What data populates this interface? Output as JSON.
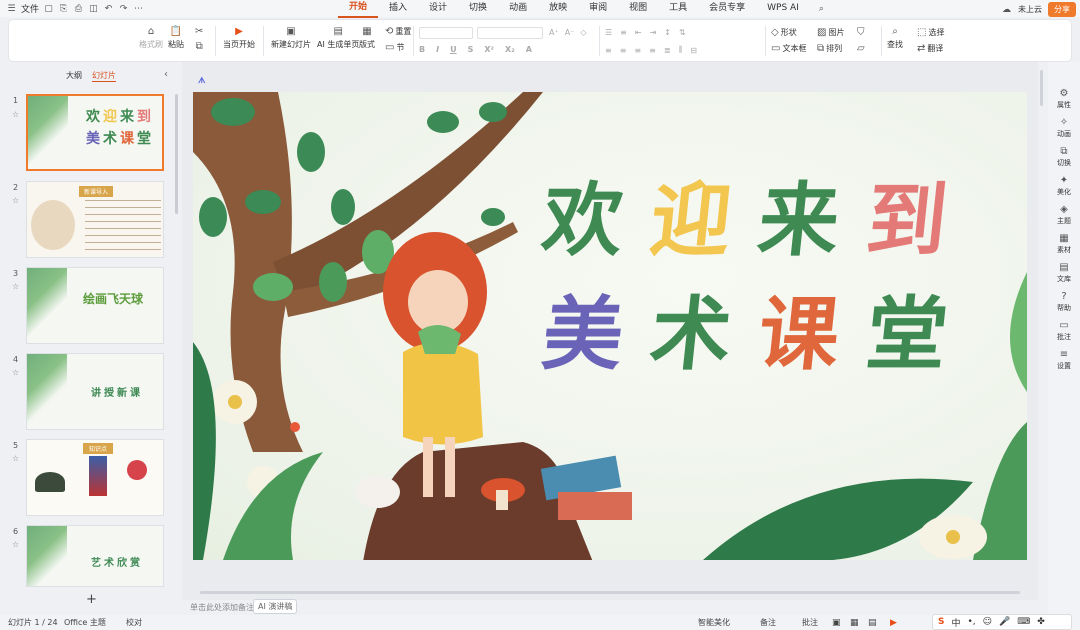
{
  "menubar": {
    "file_label": "文件",
    "tabs": [
      "开始",
      "插入",
      "设计",
      "切换",
      "动画",
      "放映",
      "审阅",
      "视图",
      "工具",
      "会员专享",
      "WPS AI"
    ],
    "active_tab": "开始",
    "cloud_label": "未上云",
    "share_label": "分享"
  },
  "ribbon": {
    "format_painter": "格式刷",
    "paste": "粘贴",
    "start_from_current": "当页开始",
    "new_slide": "新建幻灯片",
    "ai_generate": "AI 生成单页",
    "layout": "版式",
    "reset": "重置",
    "section": "节",
    "shape": "形状",
    "picture": "图片",
    "textbox": "文本框",
    "arrange": "排列",
    "find": "查找",
    "select": "选择",
    "translate": "翻译",
    "font_size_buttons": [
      "A⁺",
      "A⁻",
      "◇"
    ]
  },
  "panel": {
    "tab_outline": "大纲",
    "tab_slides": "幻灯片",
    "active_tab": "幻灯片",
    "thumbnails": [
      {
        "num": "1",
        "title": "欢迎来到 美术课堂"
      },
      {
        "num": "2",
        "title": "新课导入"
      },
      {
        "num": "3",
        "title": "绘画飞天球"
      },
      {
        "num": "4",
        "title": "讲授新课"
      },
      {
        "num": "5",
        "title": "知识点"
      },
      {
        "num": "6",
        "title": "艺术欣赏"
      }
    ]
  },
  "slide": {
    "title_line1": [
      "欢",
      "迎",
      "来",
      "到"
    ],
    "title_line2": [
      "美",
      "术",
      "课",
      "堂"
    ],
    "colors_line1": [
      "#3e8a52",
      "#f2c64f",
      "#3e8a52",
      "#e47a78"
    ],
    "colors_line2": [
      "#6a64b8",
      "#3e8a52",
      "#e0673c",
      "#3e8a52"
    ]
  },
  "notes_hint": "单击此处添加备注",
  "ai_speech": "AI 演讲稿",
  "sidebar": [
    "属性",
    "动画",
    "切换",
    "美化",
    "主题",
    "素材",
    "文库",
    "帮助",
    "批注",
    "设置"
  ],
  "status": {
    "slide_count": "幻灯片 1 / 24",
    "theme": "Office 主题",
    "proofing": "校对",
    "smart_beautify": "智能美化",
    "notes": "备注",
    "comments": "批注"
  },
  "ime": {
    "mode": "中"
  }
}
